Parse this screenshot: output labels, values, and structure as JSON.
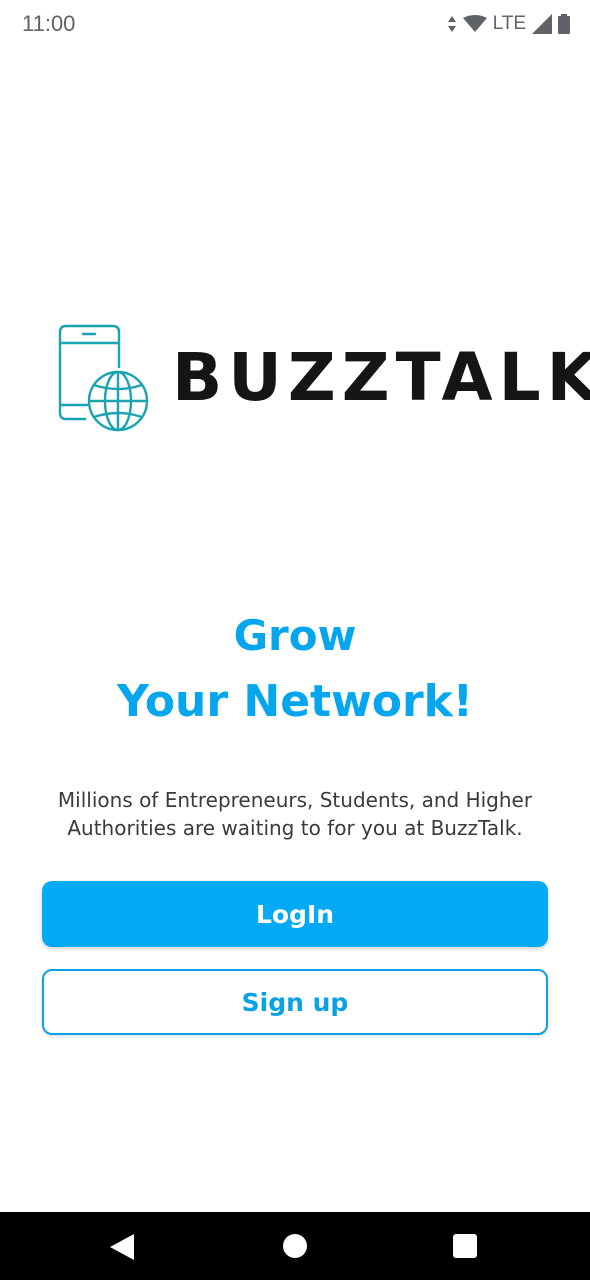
{
  "status_bar": {
    "time": "11:00",
    "network": "LTE",
    "icons": [
      "data-arrows-icon",
      "wifi-icon",
      "cell-signal-icon",
      "battery-icon"
    ]
  },
  "brand": {
    "name": "BUZZTALK",
    "logo_icon": "phone-globe-icon",
    "logo_color": "#1aa3b0"
  },
  "hero": {
    "line1": "Grow",
    "line2": "Your Network!",
    "accent_color": "#06a6ee"
  },
  "tagline": "Millions of Entrepreneurs, Students, and Higher Authorities are waiting to for you at BuzzTalk.",
  "actions": {
    "login_label": "LogIn",
    "signup_label": "Sign up"
  },
  "nav_bar": {
    "icons": [
      "back-icon",
      "home-icon",
      "recents-icon"
    ]
  }
}
